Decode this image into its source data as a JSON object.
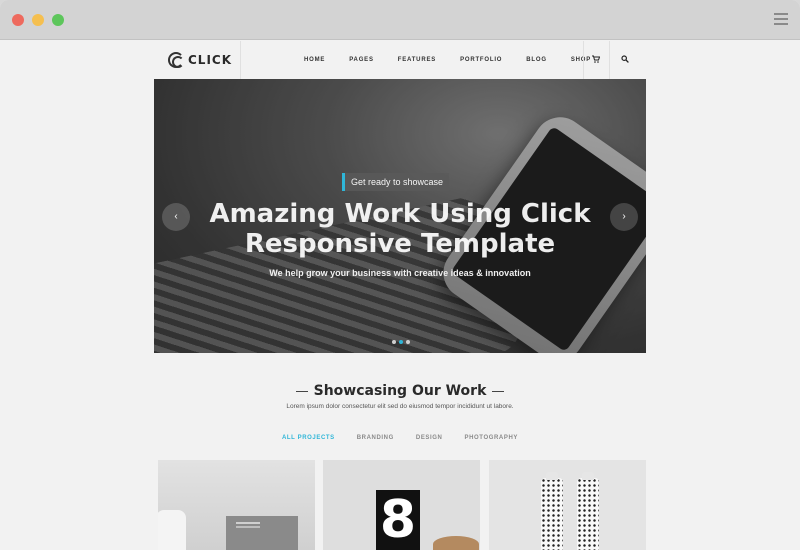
{
  "site": {
    "logo_text": "CLICK"
  },
  "nav": {
    "items": [
      {
        "label": "HOME"
      },
      {
        "label": "PAGES"
      },
      {
        "label": "FEATURES"
      },
      {
        "label": "PORTFOLIO"
      },
      {
        "label": "BLOG"
      },
      {
        "label": "SHOP"
      }
    ],
    "cart_icon": "cart-icon",
    "search_icon": "search-icon"
  },
  "hero": {
    "tagline": "Get ready to showcase",
    "title_line1": "Amazing Work Using Click",
    "title_line2": "Responsive Template",
    "subtitle": "We help grow your business with creative ideas & innovation",
    "prev_icon": "‹",
    "next_icon": "›",
    "slide_count": 3,
    "active_slide": 2
  },
  "work": {
    "title": "Showcasing Our Work",
    "subtitle": "Lorem ipsum dolor consectetur elit sed do eiusmod tempor incididunt ut labore.",
    "filters": [
      {
        "label": "ALL PROJECTS",
        "active": true
      },
      {
        "label": "BRANDING",
        "active": false
      },
      {
        "label": "DESIGN",
        "active": false
      },
      {
        "label": "PHOTOGRAPHY",
        "active": false
      }
    ]
  },
  "cards": [
    {
      "graphic": "8"
    }
  ],
  "colors": {
    "accent": "#2fb6d8",
    "window_red": "#ee6a5e",
    "window_yellow": "#f5bf4f",
    "window_green": "#5dc65b"
  }
}
